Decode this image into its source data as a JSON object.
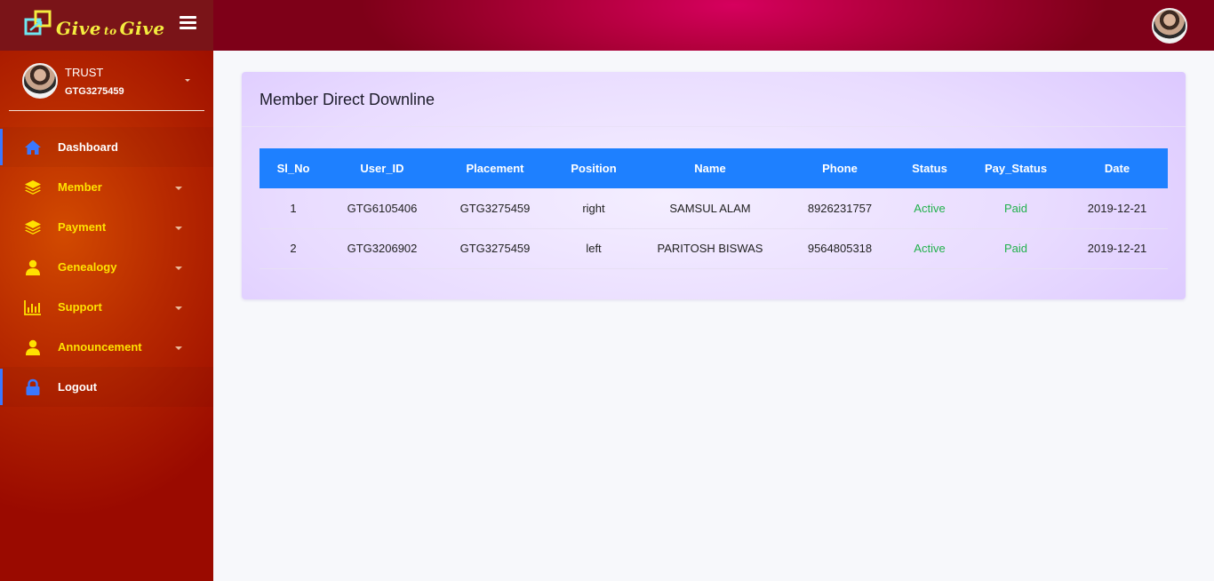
{
  "brand": {
    "name_part1": "Give",
    "name_part2": "to",
    "name_part3": "Give"
  },
  "user": {
    "name": "TRUST",
    "id": "GTG3275459"
  },
  "nav": [
    {
      "label": "Dashboard",
      "icon": "home-icon",
      "has_submenu": false
    },
    {
      "label": "Member",
      "icon": "layers-icon",
      "has_submenu": true
    },
    {
      "label": "Payment",
      "icon": "layers-icon",
      "has_submenu": true
    },
    {
      "label": "Genealogy",
      "icon": "user-icon",
      "has_submenu": true
    },
    {
      "label": "Support",
      "icon": "bar-chart-icon",
      "has_submenu": true
    },
    {
      "label": "Announcement",
      "icon": "user-icon",
      "has_submenu": true
    },
    {
      "label": "Logout",
      "icon": "lock-icon",
      "has_submenu": false
    }
  ],
  "card": {
    "title": "Member Direct Downline"
  },
  "table": {
    "headers": [
      "Sl_No",
      "User_ID",
      "Placement",
      "Position",
      "Name",
      "Phone",
      "Status",
      "Pay_Status",
      "Date"
    ],
    "rows": [
      [
        "1",
        "GTG6105406",
        "GTG3275459",
        "right",
        "SAMSUL ALAM",
        "8926231757",
        "Active",
        "Paid",
        "2019-12-21"
      ],
      [
        "2",
        "GTG3206902",
        "GTG3275459",
        "left",
        "PARITOSH BISWAS",
        "9564805318",
        "Active",
        "Paid",
        "2019-12-21"
      ]
    ]
  },
  "colors": {
    "accent_blue": "#1e80ff",
    "status_green": "#22b14c",
    "nav_yellow": "#ffe100",
    "sidebar": "#b82a00",
    "topbar": "#b4003e"
  }
}
